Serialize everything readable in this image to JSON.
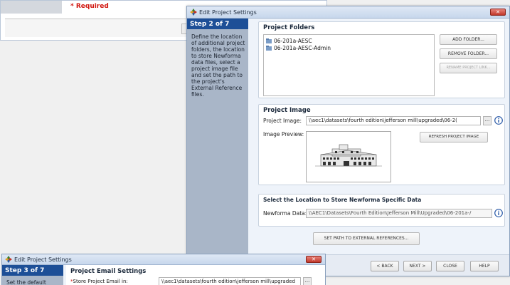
{
  "background_window": {
    "required_text": "* Required"
  },
  "dialog": {
    "title": "Edit Project Settings",
    "close_label": "✕",
    "step": "Step 2 of 7",
    "description": "Define the location of additional project folders, the location to store Newforma data files, select a project image file and set the path to the project's External Reference files.",
    "folders": {
      "title": "Project Folders",
      "items": [
        "06-201a-AESC",
        "06-201a-AESC-Admin"
      ],
      "add_button": "ADD FOLDER...",
      "remove_button": "REMOVE FOLDER...",
      "rename_button": "RENAME PROJECT LINK..."
    },
    "image": {
      "title": "Project Image",
      "image_label": "Project Image:",
      "image_path": "\\\\aec1\\datasets\\fourth edition\\jefferson mill\\upgraded\\06-2(",
      "preview_label": "Image Preview:",
      "refresh_button": "REFRESH PROJECT IMAGE",
      "dots": "..."
    },
    "data_location": {
      "title": "Select the Location to Store Newforma Specific Data",
      "label": "Newforma Data:",
      "path": "\\\\AEC1\\Datasets\\Fourth Edition\\Jefferson Mill\\Upgraded\\06-201a-/"
    },
    "set_path_button": "SET PATH TO EXTERNAL REFERENCES...",
    "footer": {
      "back": "< BACK",
      "next": "NEXT >",
      "close": "CLOSE",
      "help": "HELP"
    }
  },
  "dialog2": {
    "title": "Edit Project Settings",
    "close_label": "✕",
    "step": "Step 3 of 7",
    "description": "Set the default",
    "section_title": "Project Email Settings",
    "email_label": "Store Project Email in:",
    "email_path": "\\\\aec1\\datasets\\fourth edition\\jefferson mill\\upgraded",
    "dots": "..."
  },
  "colors": {
    "step_highlight": "#1d4f97",
    "sidebar_bg": "#a9b6c8",
    "required_red": "#d1160f",
    "close_red": "#c1372a"
  }
}
